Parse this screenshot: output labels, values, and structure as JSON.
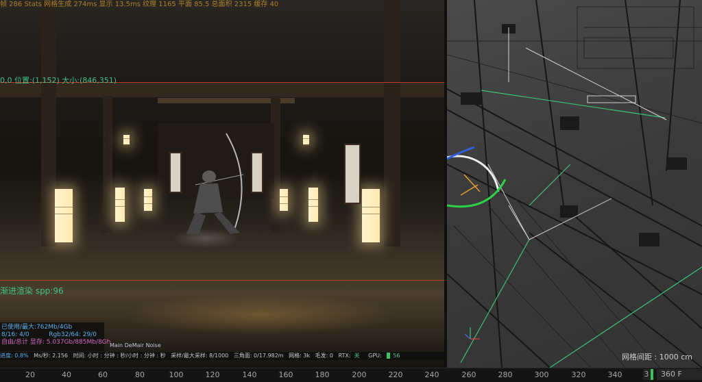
{
  "render": {
    "top_overlay": "帧 286 Stats  网格生成 274ms  显示 13.5ms  纹理 1165  平面 85.5  总面积 2315  缓存 40",
    "region_info": "0,0 位置:(1,152) 大小:(846,351)",
    "progressive_label": "渐进渲染 spp:96",
    "memory": {
      "row1": "已使用/最大:762Mb/4Gb",
      "row2a": "8/16: 4/0",
      "row2b": "Rgb32/64: 29/0",
      "row3": "自由/总计 显存: 5.037Gb/885Mb/8Gb"
    },
    "buffer_label": "Main DeMair Noise",
    "stats": {
      "progress": "进度: 0.8%",
      "ms": "Ms/秒: 2.156",
      "time": "时间: 小时 : 分钟 : 秒/小时 : 分钟 : 秒",
      "samples": "采样/最大采样: 8/1000",
      "triangles": "三角面: 0/17.982m",
      "hair_map": "网格: 3k",
      "hair": "毛发: 0",
      "rtx": "RTX:",
      "rtx_value": "关",
      "gpu": "GPU:",
      "gpu_value": "56"
    },
    "colors": {
      "hud_orange": "#d8a030",
      "info_green": "#42c28c",
      "region_red": "#c23a22",
      "mem_blue": "#5ab0ea"
    }
  },
  "viewport": {
    "grid_spacing_label": "网格间距 : 1000 cm"
  },
  "timeline": {
    "ticks": [
      "20",
      "40",
      "60",
      "80",
      "100",
      "120",
      "140",
      "160",
      "180",
      "200",
      "220",
      "240",
      "260",
      "280",
      "300",
      "320",
      "340"
    ],
    "current_frame": "3",
    "end_frame": "360 F",
    "marker_color": "#3ac060"
  }
}
